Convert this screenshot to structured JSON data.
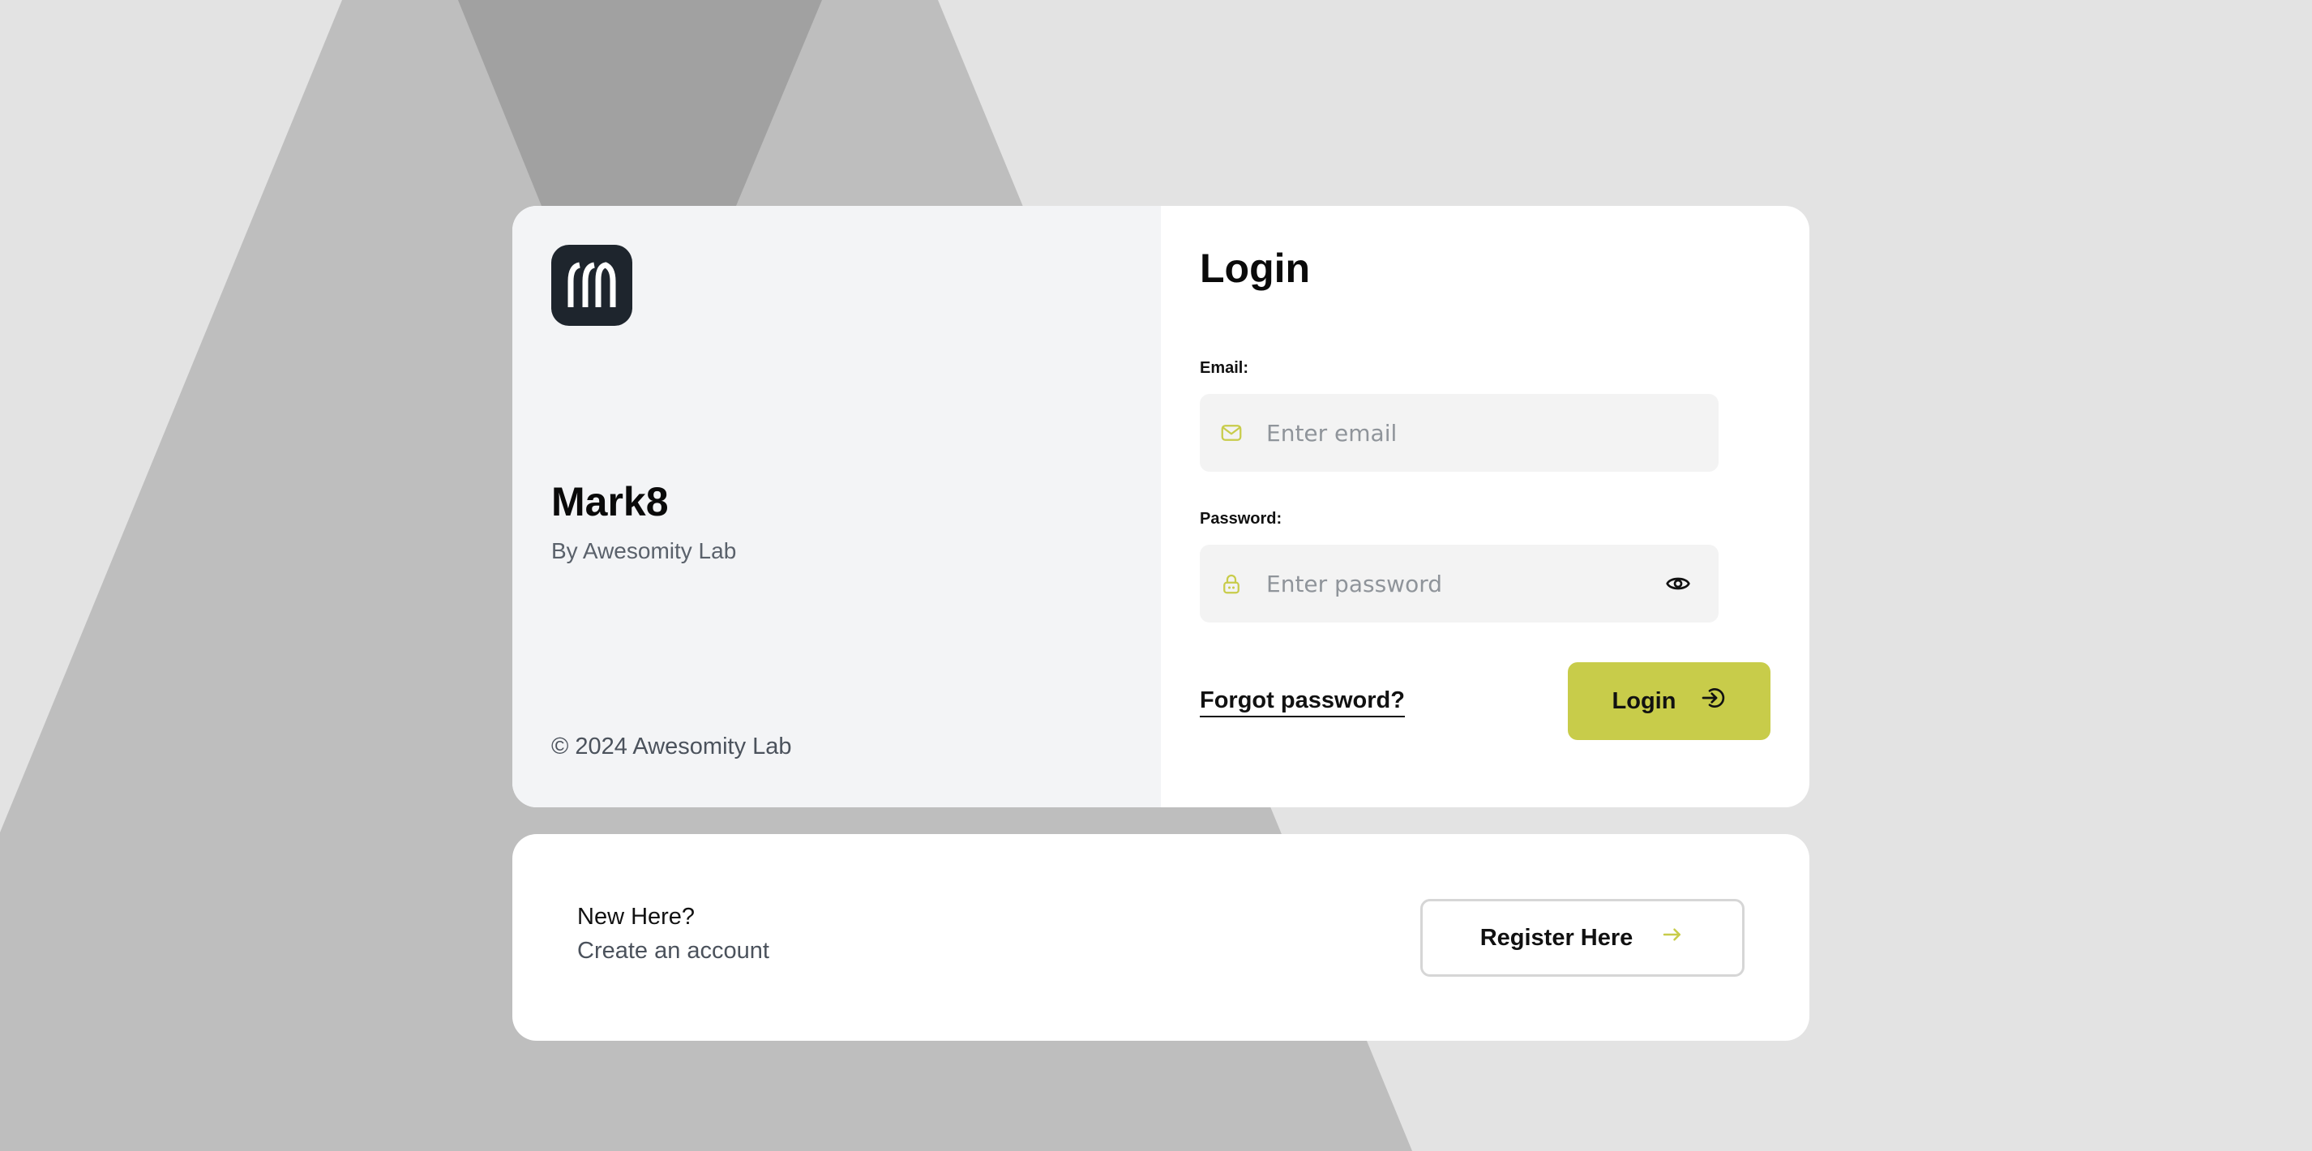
{
  "brand": {
    "logo_icon": "m8-logo-icon",
    "app_name": "Mark8",
    "byline": "By Awesomity Lab",
    "copyright": "© 2024 Awesomity Lab"
  },
  "login_form": {
    "title": "Login",
    "email": {
      "label": "Email:",
      "value": "",
      "placeholder": "Enter email",
      "icon": "mail-icon"
    },
    "password": {
      "label": "Password:",
      "value": "",
      "placeholder": "Enter password",
      "icon": "lock-icon",
      "toggle_icon": "eye-icon"
    },
    "forgot_password_label": "Forgot password?",
    "submit_label": "Login",
    "submit_icon": "login-arrow-icon"
  },
  "register": {
    "heading": "New Here?",
    "subheading": "Create an account",
    "button_label": "Register Here",
    "button_icon": "arrow-right-icon"
  },
  "colors": {
    "accent": "#c8cc4a",
    "logo_bg": "#1e252d",
    "page_bg": "#e3e3e3",
    "brand_panel_bg": "#f3f4f6",
    "field_bg": "#f3f3f3"
  }
}
